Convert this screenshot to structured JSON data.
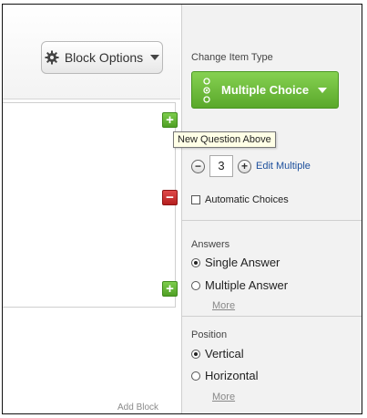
{
  "toolbar": {
    "block_options_label": "Block Options"
  },
  "editor": {
    "tooltip": "New Question Above",
    "add_block_label": "Add Block",
    "add_above_symbol": "+",
    "remove_symbol": "−",
    "add_below_symbol": "+"
  },
  "panel": {
    "change_item_type_label": "Change Item Type",
    "item_type_value": "Multiple Choice",
    "choices": {
      "minus_symbol": "−",
      "value": "3",
      "plus_symbol": "+",
      "edit_multiple_label": "Edit Multiple"
    },
    "automatic_choices_label": "Automatic Choices",
    "answers": {
      "heading": "Answers",
      "options": [
        "Single Answer",
        "Multiple Answer"
      ],
      "selected": "Single Answer",
      "more_label": "More"
    },
    "position": {
      "heading": "Position",
      "options": [
        "Vertical",
        "Horizontal"
      ],
      "selected": "Vertical",
      "more_label": "More"
    }
  },
  "colors": {
    "accent_green": "#5aa82b",
    "remove_red": "#c62828",
    "link_blue": "#1c4f9c"
  },
  "icons": {
    "block_options": "gear-icon",
    "item_type": "three-dots-icon",
    "dropdown": "chevron-down-icon"
  }
}
